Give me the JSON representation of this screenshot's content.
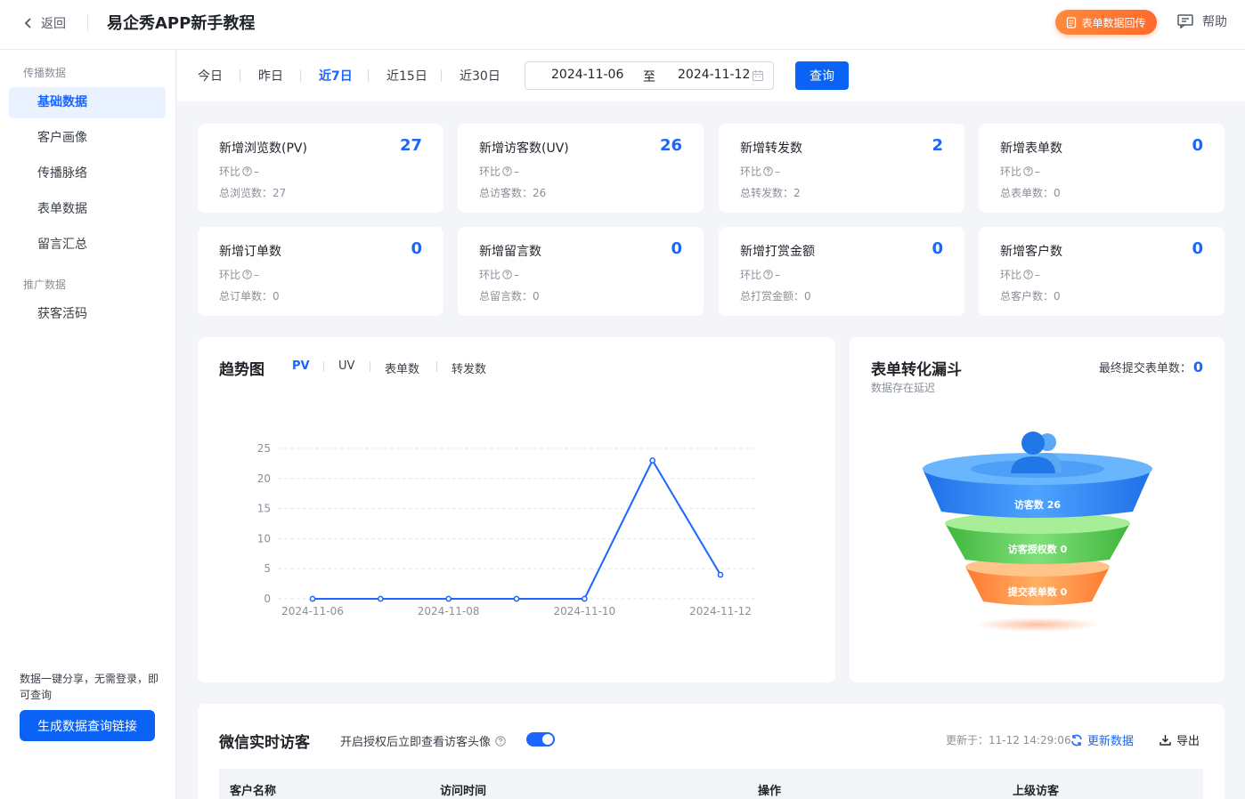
{
  "header": {
    "back_label": "返回",
    "title": "易企秀APP新手教程",
    "form_return_label": "表单数据回传",
    "help_label": "帮助"
  },
  "sidebar": {
    "group1": "传播数据",
    "items": [
      {
        "label": "基础数据",
        "active": true
      },
      {
        "label": "客户画像"
      },
      {
        "label": "传播脉络"
      },
      {
        "label": "表单数据"
      },
      {
        "label": "留言汇总"
      }
    ],
    "group2": "推广数据",
    "items2": [
      {
        "label": "获客活码"
      }
    ],
    "tip": "数据一键分享，无需登录，即可查询",
    "generate_label": "生成数据查询链接"
  },
  "filter": {
    "ranges": [
      "今日",
      "昨日",
      "近7日",
      "近15日",
      "近30日"
    ],
    "active_range": "近7日",
    "start_date": "2024-11-06",
    "to_label": "至",
    "end_date": "2024-11-12",
    "query_label": "查询"
  },
  "stats": [
    {
      "title": "新增浏览数(PV)",
      "value": "27",
      "ratio_label": "环比",
      "ratio": "–",
      "total": "总浏览数：27"
    },
    {
      "title": "新增访客数(UV)",
      "value": "26",
      "ratio_label": "环比",
      "ratio": "–",
      "total": "总访客数：26"
    },
    {
      "title": "新增转发数",
      "value": "2",
      "ratio_label": "环比",
      "ratio": "–",
      "total": "总转发数：2"
    },
    {
      "title": "新增表单数",
      "value": "0",
      "ratio_label": "环比",
      "ratio": "–",
      "total": "总表单数：0"
    },
    {
      "title": "新增订单数",
      "value": "0",
      "ratio_label": "环比",
      "ratio": "–",
      "total": "总订单数：0"
    },
    {
      "title": "新增留言数",
      "value": "0",
      "ratio_label": "环比",
      "ratio": "–",
      "total": "总留言数：0"
    },
    {
      "title": "新增打赏金额",
      "value": "0",
      "ratio_label": "环比",
      "ratio": "–",
      "total": "总打赏金额：0"
    },
    {
      "title": "新增客户数",
      "value": "0",
      "ratio_label": "环比",
      "ratio": "–",
      "total": "总客户数：0"
    }
  ],
  "trend": {
    "title": "趋势图",
    "tabs": [
      "PV",
      "UV",
      "表单数",
      "转发数"
    ],
    "active_tab": "PV"
  },
  "chart_data": {
    "type": "line",
    "x": [
      "2024-11-06",
      "2024-11-07",
      "2024-11-08",
      "2024-11-09",
      "2024-11-10",
      "2024-11-11",
      "2024-11-12"
    ],
    "x_tick_labels": [
      "2024-11-06",
      "2024-11-08",
      "2024-11-10",
      "2024-11-12"
    ],
    "series": [
      {
        "values": [
          0,
          0,
          0,
          0,
          0,
          23,
          4
        ]
      }
    ],
    "ylim": [
      0,
      25
    ],
    "yticks": [
      0,
      5,
      10,
      15,
      20,
      25
    ],
    "grid": true,
    "color": "#1a66ff"
  },
  "funnel": {
    "title": "表单转化漏斗",
    "subtitle": "数据存在延迟",
    "final_label": "最终提交表单数：",
    "final_value": "0",
    "levels": [
      {
        "label": "访客数 26",
        "color": "#2f86f6"
      },
      {
        "label": "访客授权数 0",
        "color": "#4cc94a"
      },
      {
        "label": "提交表单数 0",
        "color": "#ff8a3d"
      }
    ]
  },
  "visitors": {
    "title": "微信实时访客",
    "desc": "开启授权后立即查看访客头像",
    "toggle_on": true,
    "updated": "更新于：11-12 14:29:06",
    "refresh_label": "更新数据",
    "export_label": "导出",
    "columns": [
      "客户名称",
      "访问时间",
      "操作",
      "上级访客"
    ]
  }
}
